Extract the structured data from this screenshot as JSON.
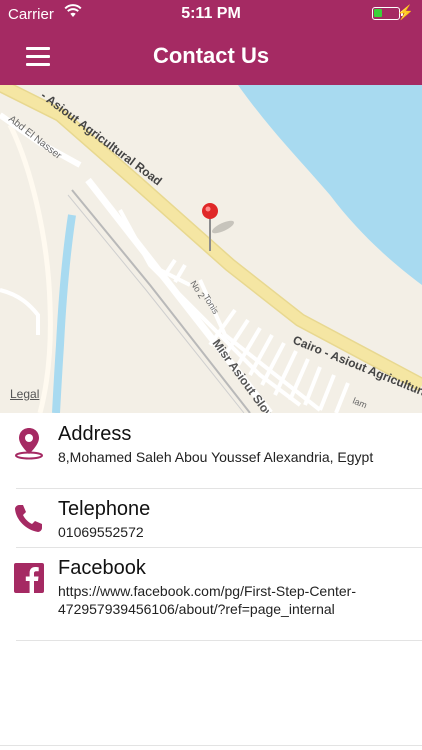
{
  "status_bar": {
    "carrier": "Carrier",
    "time": "5:11 PM",
    "battery_fraction": 0.35
  },
  "nav": {
    "title": "Contact Us"
  },
  "map": {
    "road_label_1": "- Asiout Agricultural Road",
    "road_label_2": "Cairo - Asiout Agricultural",
    "road_label_3": "Misr Asiout Slow R",
    "street_label_1": "Abd El Nasser",
    "street_label_2": "No 2",
    "street_label_3": "Tonis",
    "street_label_4": "lam",
    "legal": "Legal"
  },
  "contact": {
    "address": {
      "title": "Address",
      "value": "8,Mohamed Saleh Abou Youssef Alexandria, Egypt"
    },
    "telephone": {
      "title": "Telephone",
      "value": "01069552572"
    },
    "facebook": {
      "title": "Facebook",
      "value": "https://www.facebook.com/pg/First-Step-Center-472957939456106/about/?ref=page_internal"
    }
  },
  "colors": {
    "brand": "#a52a63",
    "water": "#a8daf0",
    "road": "#f5e6a3"
  }
}
